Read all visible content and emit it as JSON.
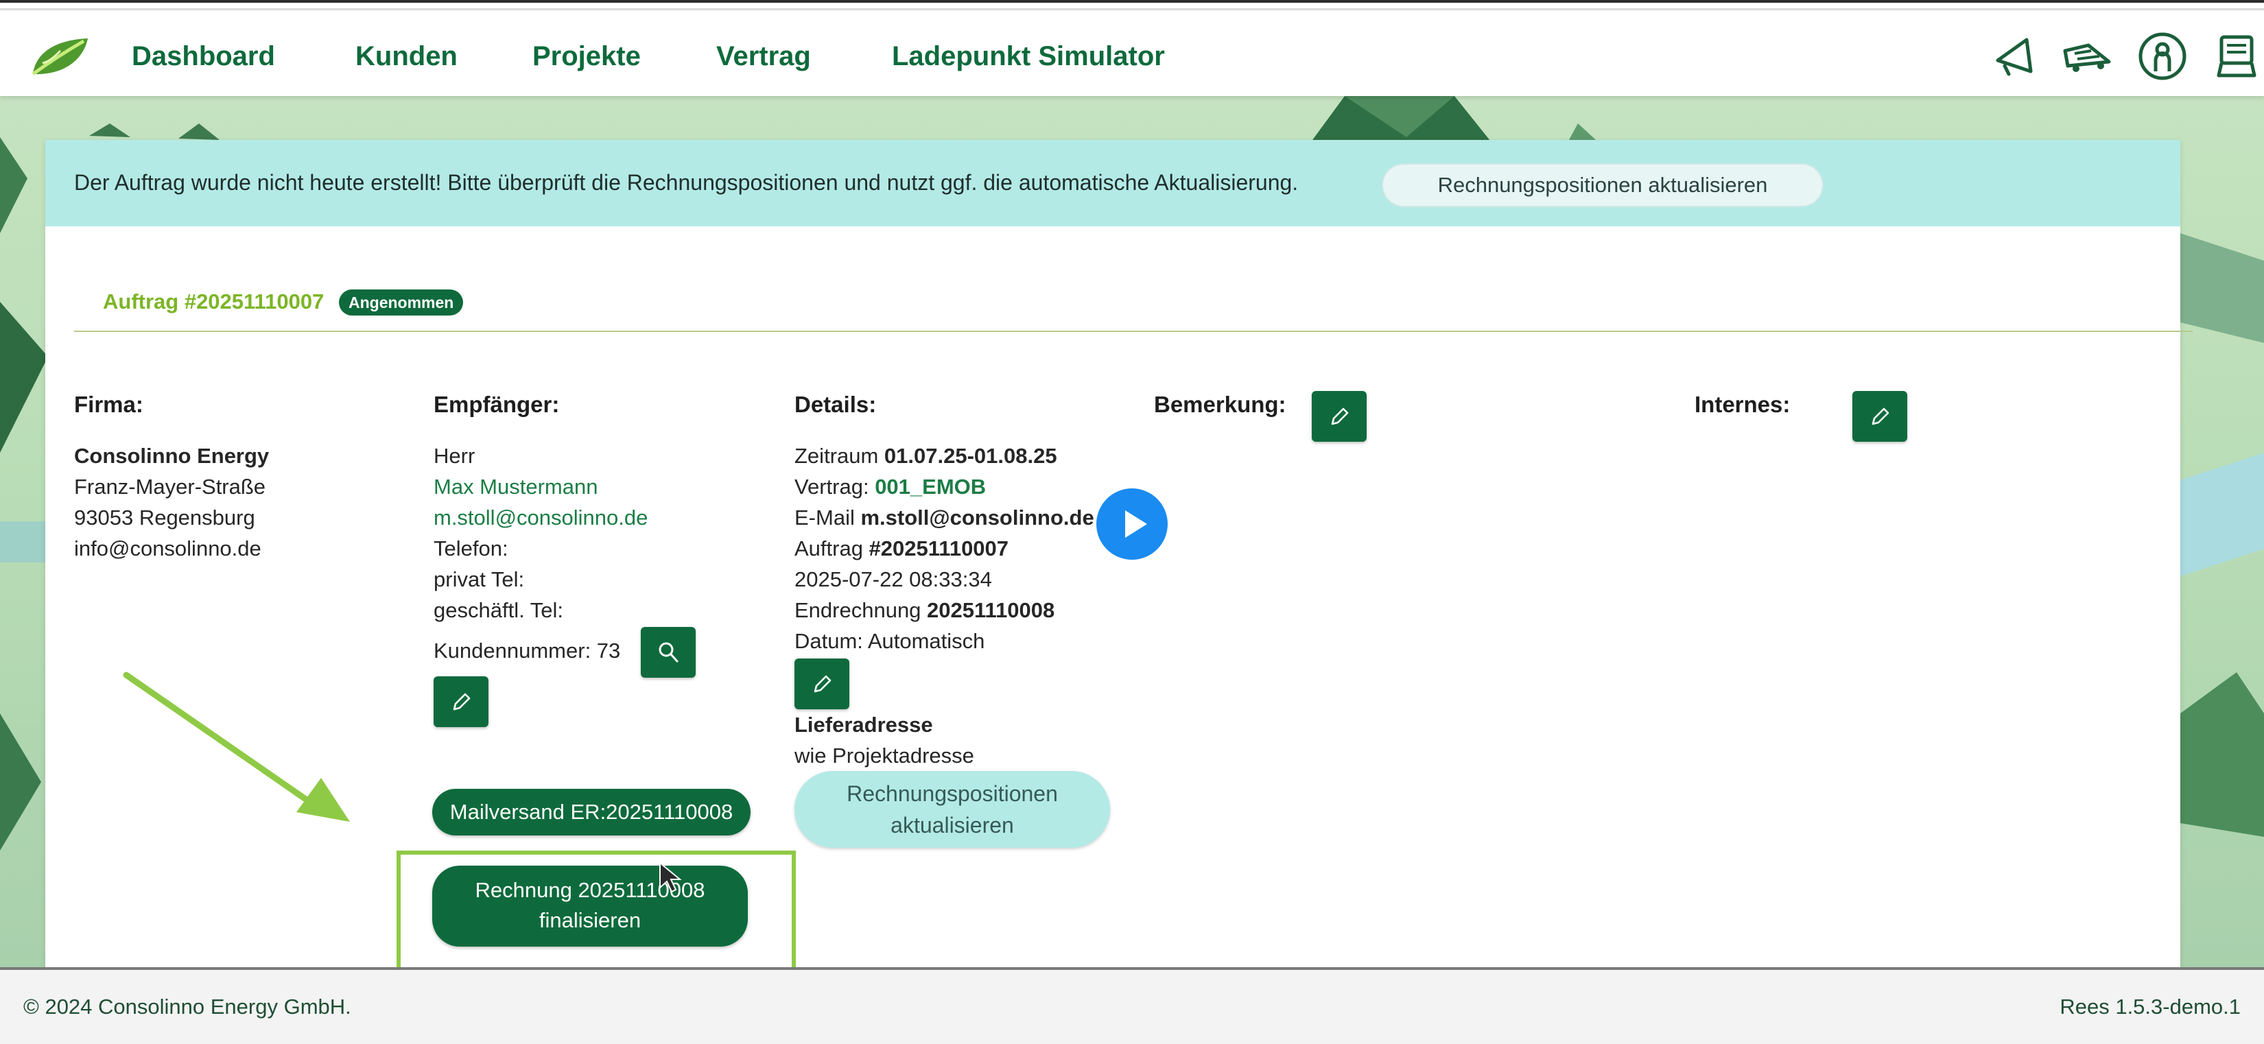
{
  "nav": {
    "items": [
      {
        "label": "Dashboard"
      },
      {
        "label": "Kunden"
      },
      {
        "label": "Projekte"
      },
      {
        "label": "Vertrag"
      },
      {
        "label": "Ladepunkt Simulator"
      }
    ],
    "icons": [
      "megaphone-icon",
      "truck-icon",
      "user-icon",
      "cart-icon"
    ]
  },
  "banner": {
    "text": "Der Auftrag wurde nicht heute erstellt! Bitte überprüft die Rechnungspositionen und nutzt ggf. die automatische Aktualisierung.",
    "button": "Rechnungspositionen aktualisieren"
  },
  "order": {
    "prefix": "Auftrag ",
    "number": "#20251110007",
    "status": "Angenommen"
  },
  "firma": {
    "heading": "Firma:",
    "name": "Consolinno Energy",
    "street": "Franz-Mayer-Straße",
    "city": "93053 Regensburg",
    "email": "info@consolinno.de"
  },
  "empfaenger": {
    "heading": "Empfänger:",
    "salutation": "Herr",
    "name": "Max Mustermann",
    "email": "m.stoll@consolinno.de",
    "telefon": "Telefon:",
    "privat": "privat Tel:",
    "geschaeftl": "geschäftl. Tel:",
    "kundennummer": "Kundennummer: 73"
  },
  "details": {
    "heading": "Details:",
    "zeitraum_label": "Zeitraum ",
    "zeitraum": "01.07.25-01.08.25",
    "vertrag_label": "Vertrag: ",
    "vertrag": "001_EMOB",
    "email_label": "E-Mail ",
    "email": "m.stoll@consolinno.de",
    "auftrag_label": "Auftrag ",
    "auftrag": "#20251110007",
    "timestamp": "2025-07-22 08:33:34",
    "endrechnung_label": "Endrechnung ",
    "endrechnung": "20251110008",
    "datum": "Datum: Automatisch",
    "lieferadresse_heading": "Lieferadresse",
    "lieferadresse": "wie Projektadresse",
    "update_button_line1": "Rechnungspositionen",
    "update_button_line2": "aktualisieren"
  },
  "bemerkung": {
    "heading": "Bemerkung:"
  },
  "internes": {
    "heading": "Internes:"
  },
  "actions": {
    "mailversand": "Mailversand ER:20251110008",
    "finalize_line1": "Rechnung 20251110008",
    "finalize_line2": "finalisieren"
  },
  "footer": {
    "copyright": "© 2024 Consolinno Energy GmbH.",
    "version": "Rees 1.5.3-demo.1"
  },
  "colors": {
    "brand_green": "#0e6a3c",
    "accent_green": "#7cb526",
    "banner_bg": "#b3eae6",
    "annotation_green": "#8fca46"
  }
}
